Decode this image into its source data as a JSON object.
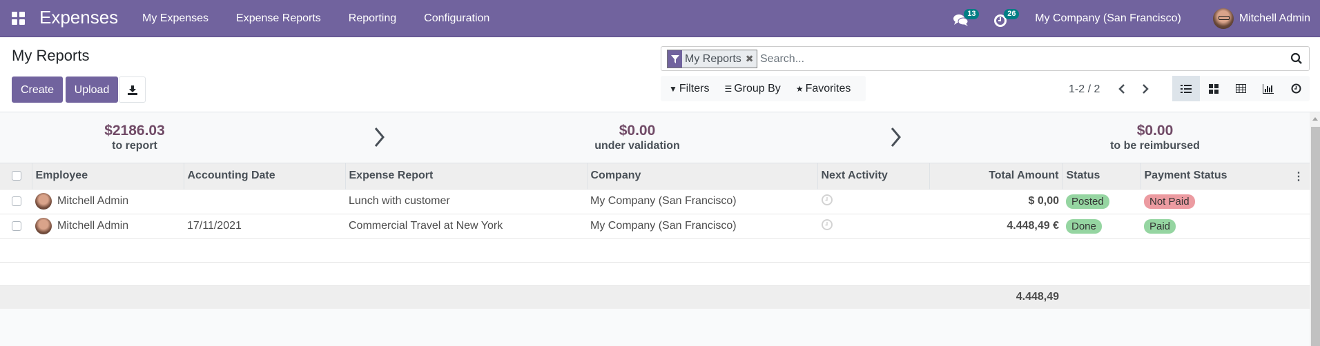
{
  "navbar": {
    "app_name": "Expenses",
    "menu": [
      {
        "label": "My Expenses"
      },
      {
        "label": "Expense Reports"
      },
      {
        "label": "Reporting"
      },
      {
        "label": "Configuration"
      }
    ],
    "messages_count": "13",
    "activities_count": "26",
    "company": "My Company (San Francisco)",
    "user": "Mitchell Admin"
  },
  "control_panel": {
    "title": "My Reports",
    "create_label": "Create",
    "upload_label": "Upload",
    "download_icon": "download-icon",
    "search": {
      "facet_label": "My Reports",
      "placeholder": "Search..."
    },
    "filters_label": "Filters",
    "groupby_label": "Group By",
    "favorites_label": "Favorites",
    "pager": "1-2 / 2",
    "views": [
      "list",
      "kanban",
      "pivot",
      "graph",
      "activity"
    ],
    "active_view": "list"
  },
  "dashboard": {
    "stats": [
      {
        "amount": "$2186.03",
        "label": "to report"
      },
      {
        "amount": "$0.00",
        "label": "under validation"
      },
      {
        "amount": "$0.00",
        "label": "to be reimbursed"
      }
    ]
  },
  "table": {
    "columns": [
      "Employee",
      "Accounting Date",
      "Expense Report",
      "Company",
      "Next Activity",
      "Total Amount",
      "Status",
      "Payment Status"
    ],
    "rows": [
      {
        "employee": "Mitchell Admin",
        "date": "",
        "report": "Lunch with customer",
        "company": "My Company (San Francisco)",
        "total": "$ 0,00",
        "status": "Posted",
        "payment": "Not Paid"
      },
      {
        "employee": "Mitchell Admin",
        "date": "17/11/2021",
        "report": "Commercial Travel at New York",
        "company": "My Company (San Francisco)",
        "total": "4.448,49 €",
        "status": "Done",
        "payment": "Paid"
      }
    ],
    "footer_total": "4.448,49"
  },
  "colors": {
    "brand": "#71639e",
    "amount": "#714b67",
    "badge": "#017e84",
    "status_green": "#95d5a1",
    "status_red": "#ec9ba1"
  }
}
